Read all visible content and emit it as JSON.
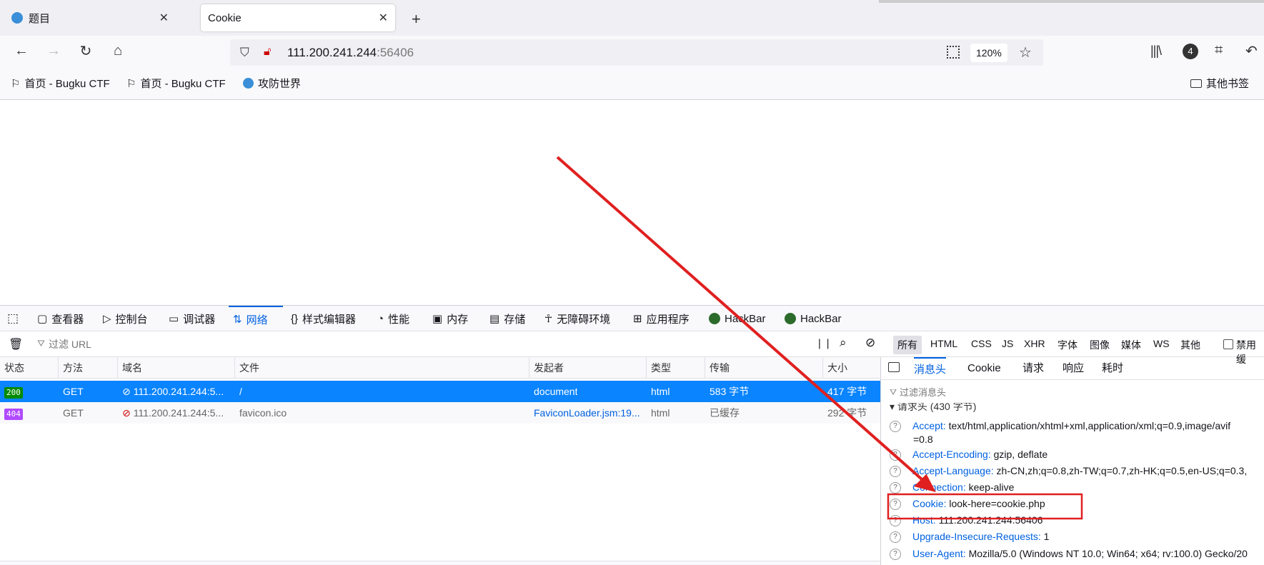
{
  "tabs": [
    {
      "title": "题目",
      "active": false
    },
    {
      "title": "Cookie",
      "active": true
    }
  ],
  "new_tab_icon": "plus-icon",
  "url": {
    "host": "111.200.241.244",
    "port": ":56406"
  },
  "zoom": "120%",
  "bookmarks": [
    {
      "label": "首页 - Bugku CTF"
    },
    {
      "label": "首页 - Bugku CTF"
    },
    {
      "label": "攻防世界"
    }
  ],
  "other_bookmarks": "其他书签",
  "account_badge": "4",
  "devtools": {
    "tabs": [
      {
        "label": "查看器"
      },
      {
        "label": "控制台"
      },
      {
        "label": "调试器"
      },
      {
        "label": "网络"
      },
      {
        "label": "样式编辑器"
      },
      {
        "label": "性能"
      },
      {
        "label": "内存"
      },
      {
        "label": "存储"
      },
      {
        "label": "无障碍环境"
      },
      {
        "label": "应用程序"
      },
      {
        "label": "HackBar"
      },
      {
        "label": "HackBar"
      }
    ],
    "filter_placeholder": "过滤 URL",
    "type_filters": [
      "所有",
      "HTML",
      "CSS",
      "JS",
      "XHR",
      "字体",
      "图像",
      "媒体",
      "WS",
      "其他"
    ],
    "disable_cache": "禁用缓",
    "columns": [
      "状态",
      "方法",
      "域名",
      "文件",
      "发起者",
      "类型",
      "传输",
      "大小"
    ],
    "rows": [
      {
        "status": "200",
        "method": "GET",
        "domain": "111.200.241.244:5...",
        "file": "/",
        "initiator": "document",
        "type": "html",
        "transfer": "583 字节",
        "size": "417 字节",
        "selected": true
      },
      {
        "status": "404",
        "method": "GET",
        "domain": "111.200.241.244:5...",
        "file": "favicon.ico",
        "initiator": "FaviconLoader.jsm:19...",
        "type": "html",
        "transfer": "已缓存",
        "size": "292 字节",
        "selected": false
      }
    ],
    "side_tabs": [
      "消息头",
      "Cookie",
      "请求",
      "响应",
      "耗时"
    ],
    "side_filter_placeholder": "过滤消息头",
    "section_title": "请求头 (430 字节)",
    "headers": [
      {
        "name": "Accept:",
        "value": "text/html,application/xhtml+xml,application/xml;q=0.9,image/avif",
        "cont": "=0.8"
      },
      {
        "name": "Accept-Encoding:",
        "value": "gzip, deflate"
      },
      {
        "name": "Accept-Language:",
        "value": "zh-CN,zh;q=0.8,zh-TW;q=0.7,zh-HK;q=0.5,en-US;q=0.3,"
      },
      {
        "name": "Connection:",
        "value": "keep-alive"
      },
      {
        "name": "Cookie:",
        "value": "look-here=cookie.php"
      },
      {
        "name": "Host:",
        "value": "111.200.241.244:56406"
      },
      {
        "name": "Upgrade-Insecure-Requests:",
        "value": "1"
      },
      {
        "name": "User-Agent:",
        "value": "Mozilla/5.0 (Windows NT 10.0; Win64; x64; rv:100.0) Gecko/20"
      }
    ]
  },
  "colors": {
    "accent": "#0061e0",
    "selected_row": "#0a84ff",
    "status_200": "#058b00",
    "status_404": "#b04aff",
    "annotation": "#e02020"
  }
}
